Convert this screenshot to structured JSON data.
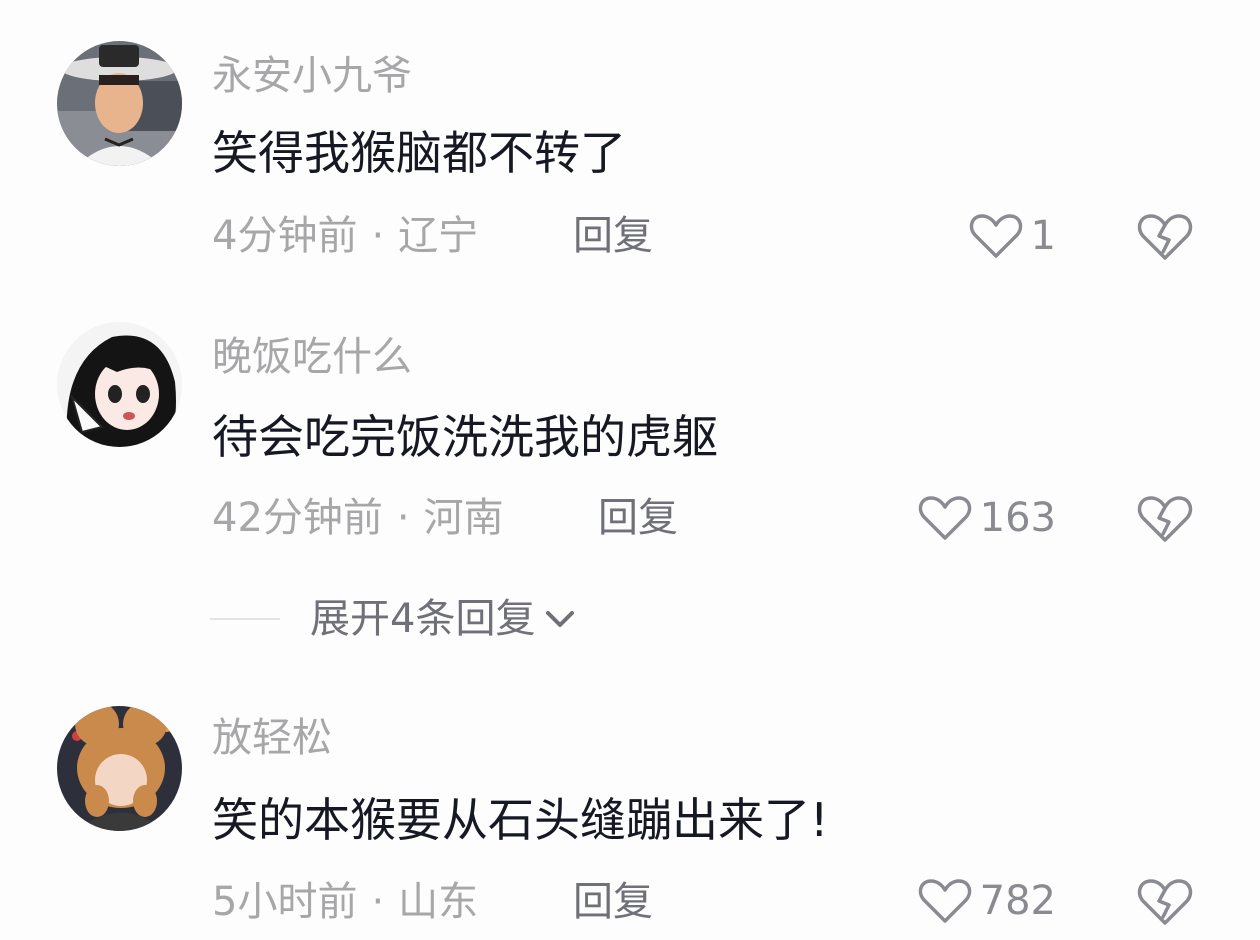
{
  "comments": [
    {
      "username": "永安小九爷",
      "text": "笑得我猴脑都不转了",
      "time": "4分钟前",
      "separator": "·",
      "location": "辽宁",
      "reply_label": "回复",
      "likes": "1"
    },
    {
      "username": "晚饭吃什么",
      "text": "待会吃完饭洗洗我的虎躯",
      "time": "42分钟前",
      "separator": "·",
      "location": "河南",
      "reply_label": "回复",
      "likes": "163"
    },
    {
      "username": "放轻松",
      "text": "笑的本猴要从石头缝蹦出来了!",
      "time": "5小时前",
      "separator": "·",
      "location": "山东",
      "reply_label": "回复",
      "likes": "782"
    }
  ],
  "expand_replies": {
    "label": "展开4条回复"
  },
  "icons": {
    "like": "heart-outline-icon",
    "dislike": "broken-heart-icon",
    "expand": "chevron-down-icon"
  },
  "colors": {
    "background": "#fdfdfd",
    "username": "#a7a7a9",
    "text": "#161823",
    "meta": "#a7a7a9",
    "reply": "#6f7078",
    "icon": "#8a8b91"
  }
}
